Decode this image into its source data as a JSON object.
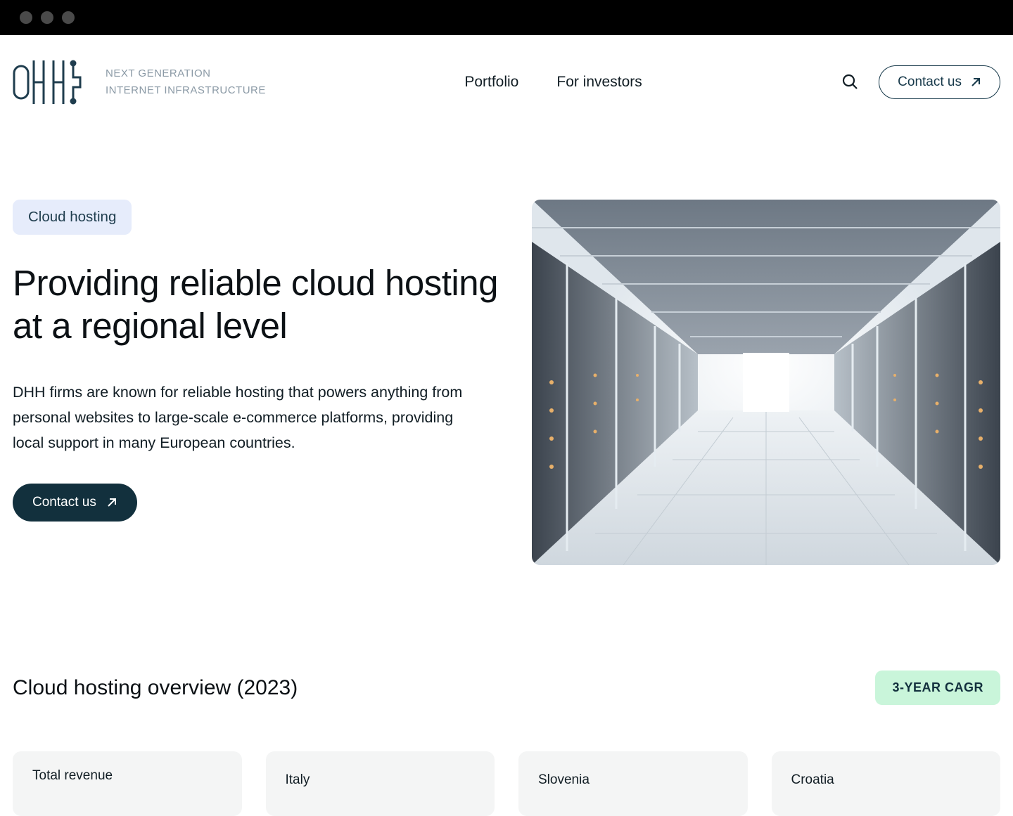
{
  "header": {
    "tagline_line1": "NEXT GENERATION",
    "tagline_line2": "INTERNET INFRASTRUCTURE",
    "nav": {
      "portfolio": "Portfolio",
      "investors": "For investors"
    },
    "contact_label": "Contact us"
  },
  "hero": {
    "tag": "Cloud hosting",
    "title": "Providing reliable cloud hosting at a regional level",
    "description": "DHH firms are known for reliable hosting that powers anything from personal websites to large-scale e-commerce platforms, providing local support in many European countries.",
    "contact_label": "Contact us"
  },
  "overview": {
    "title": "Cloud hosting overview (2023)",
    "cagr_label": "3-YEAR CAGR",
    "cards": [
      {
        "label": "Total revenue"
      },
      {
        "label": "Italy"
      },
      {
        "label": "Slovenia"
      },
      {
        "label": "Croatia"
      }
    ]
  },
  "colors": {
    "pill_bg": "#e6ecfb",
    "cagr_bg": "#c9f5da",
    "primary_dark": "#12303d"
  }
}
